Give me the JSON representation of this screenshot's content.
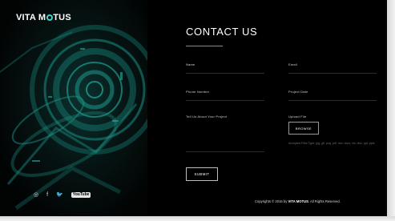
{
  "brand": {
    "logo_text_a": "VITA M",
    "logo_text_b": "TUS"
  },
  "social": {
    "facebook": "f",
    "twitter": "🐦",
    "youtube": "YouTube",
    "instagram": "◎"
  },
  "page": {
    "title": "CONTACT US"
  },
  "form": {
    "name_label": "Name",
    "email_label": "Email",
    "phone_label": "Phone Number",
    "project_date_label": "Project Date",
    "about_label": "Tell Us About Your Project",
    "upload_label": "Upload File",
    "browse_label": "BROWSE",
    "file_hint": "Accepted Files Type: jpg, gif, png, pdf, doc, docx, xls, xlsx, ppt, pptx",
    "submit_label": "SUBMIT"
  },
  "footer": {
    "copyright_prefix": "Copyrights © 2016 by",
    "copyright_brand": "VITA MOTUS",
    "copyright_suffix": ". All Rights Reserved."
  },
  "colors": {
    "accent": "#27b7aa",
    "background": "#000000",
    "text": "#ffffff"
  },
  "icons": [
    "instagram-icon",
    "facebook-icon",
    "twitter-icon",
    "youtube-icon"
  ]
}
